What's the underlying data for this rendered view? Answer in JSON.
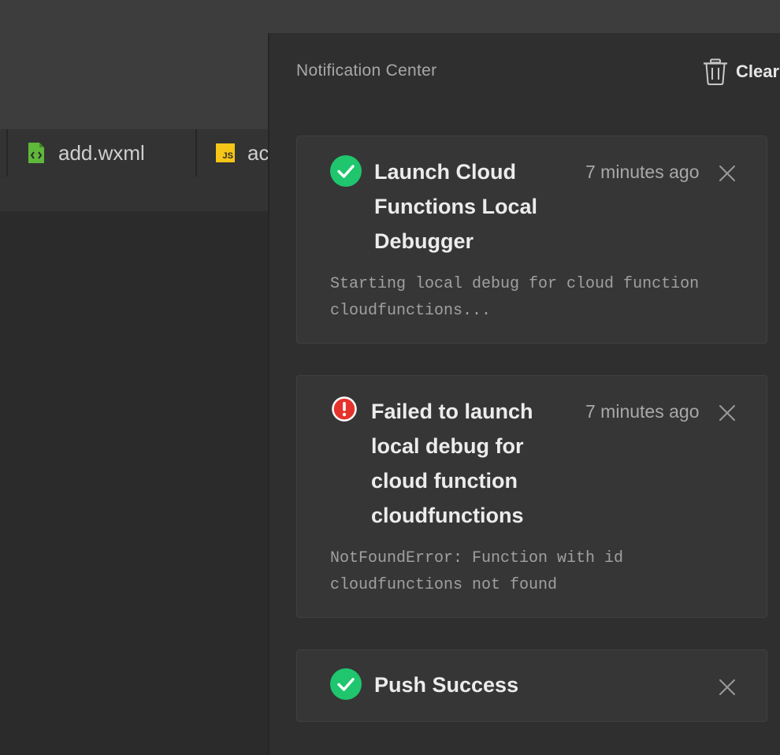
{
  "editor": {
    "tabs": [
      {
        "label": "add.wxml",
        "icon": "wxml-file-icon"
      },
      {
        "label": "ac",
        "icon": "js-file-icon",
        "icon_text": "JS"
      }
    ]
  },
  "notification_center": {
    "title": "Notification Center",
    "clear_label": "Clear",
    "notifications": [
      {
        "status": "success",
        "title": "Launch Cloud Functions Local Debugger",
        "time": "7 minutes ago",
        "body": "Starting local debug for cloud function cloudfunctions..."
      },
      {
        "status": "error",
        "title": "Failed to launch local debug for cloud function cloudfunctions",
        "time": "7 minutes ago",
        "body": "NotFoundError: Function with id cloudfunctions not found"
      },
      {
        "status": "success",
        "title": "Push Success",
        "time": "",
        "body": ""
      }
    ]
  },
  "colors": {
    "success": "#1fc66e",
    "error": "#e5322d",
    "wxml_icon": "#5fb83a",
    "js_icon": "#f5c518"
  }
}
